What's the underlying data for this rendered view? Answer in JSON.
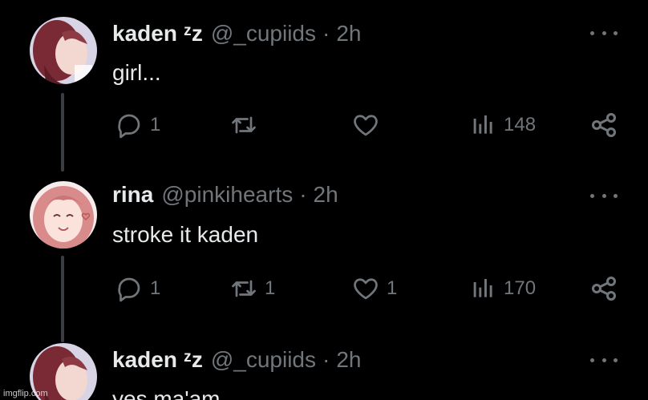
{
  "tweets": [
    {
      "name": "kaden ᶻz",
      "handle": "@_cupiids",
      "separator": "·",
      "time": "2h",
      "text": "girl...",
      "replies": "1",
      "retweets": "",
      "likes": "",
      "views": "148",
      "avatar_colors": {
        "bg": "#d8d4e6",
        "hair": "#7a2a35",
        "skin": "#f2d8d0"
      }
    },
    {
      "name": "rina",
      "handle": "@pinkihearts",
      "separator": "·",
      "time": "2h",
      "text": "stroke it kaden",
      "replies": "1",
      "retweets": "1",
      "likes": "1",
      "views": "170",
      "avatar_colors": {
        "bg": "#f6ecec",
        "hair": "#d98a8a",
        "skin": "#fbe3dc"
      }
    },
    {
      "name": "kaden ᶻz",
      "handle": "@_cupiids",
      "separator": "·",
      "time": "2h",
      "text": "yes ma'am",
      "avatar_colors": {
        "bg": "#d8d4e6",
        "hair": "#7a2a35",
        "skin": "#f2d8d0"
      }
    }
  ],
  "icons": {
    "reply": "reply-bubble-icon",
    "retweet": "retweet-arrows-icon",
    "like": "heart-icon",
    "views": "bar-chart-icon",
    "share": "share-nodes-icon",
    "more": "more-dots-icon"
  },
  "colors": {
    "background": "#000000",
    "text_primary": "#e7e9ea",
    "text_secondary": "#71767b",
    "thread_line": "#3a3e42"
  },
  "watermark": "imgflip.com"
}
